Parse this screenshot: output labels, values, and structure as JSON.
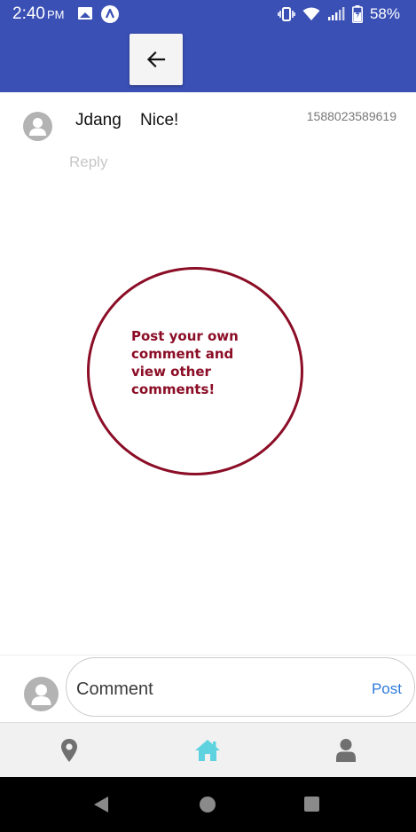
{
  "status_bar": {
    "time": "2:40",
    "ampm": "PM",
    "battery": "58%",
    "icons": [
      "gallery-icon",
      "expo-icon",
      "vibrate-icon",
      "wifi-icon",
      "signal-icon",
      "battery-icon"
    ]
  },
  "header": {
    "back_icon": "arrow-left-icon"
  },
  "comment": {
    "author": "Jdang",
    "text": "Nice!",
    "timestamp": "1588023589619",
    "reply_label": "Reply"
  },
  "annotation": {
    "text": "Post your own comment and view other comments!",
    "color": "#8b0d26"
  },
  "composer": {
    "placeholder": "Comment",
    "post_label": "Post"
  },
  "tabs": [
    {
      "icon": "map-pin-icon",
      "active": false
    },
    {
      "icon": "home-icon",
      "active": true
    },
    {
      "icon": "user-icon",
      "active": false
    }
  ],
  "colors": {
    "app_bar": "#3a50b5",
    "post_link": "#2f7ad8",
    "active_tab": "#5ed3df",
    "inactive_tab": "#707070"
  }
}
